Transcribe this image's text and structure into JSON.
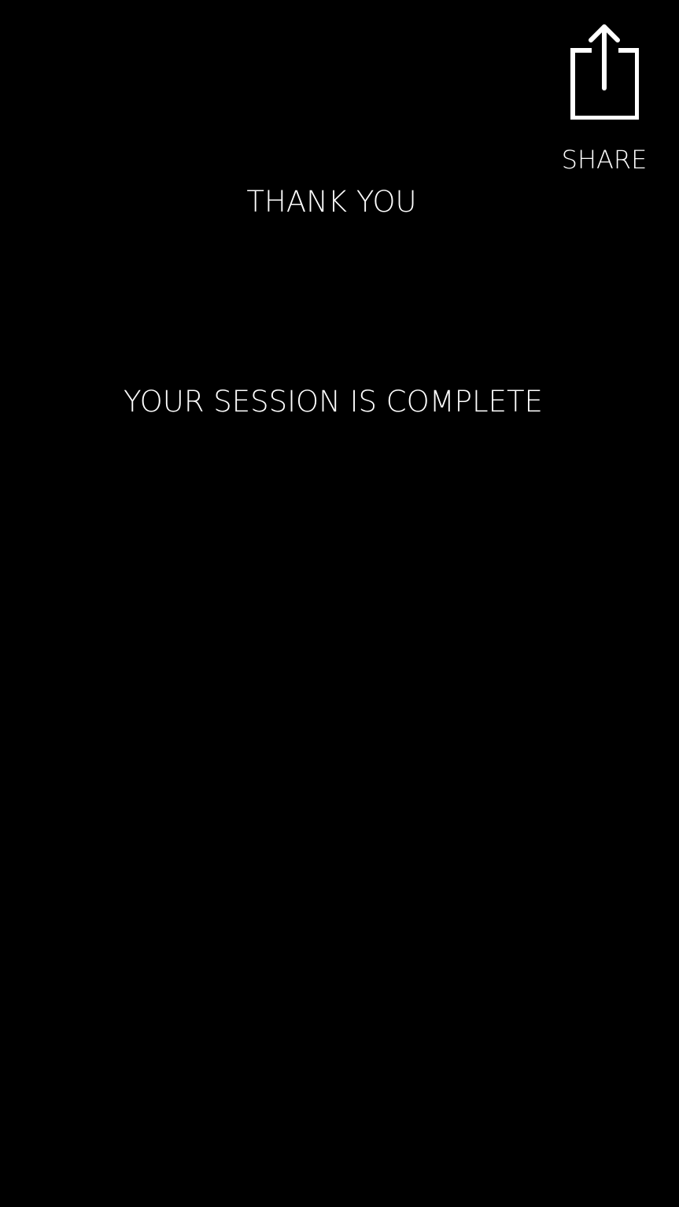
{
  "share": {
    "label": "SHARE",
    "icon": "share-icon"
  },
  "thanks": {
    "title": "THANK YOU"
  },
  "session": {
    "message": "YOUR SESSION IS COMPLETE"
  },
  "colors": {
    "background": "#000000",
    "foreground": "#ffffff"
  }
}
